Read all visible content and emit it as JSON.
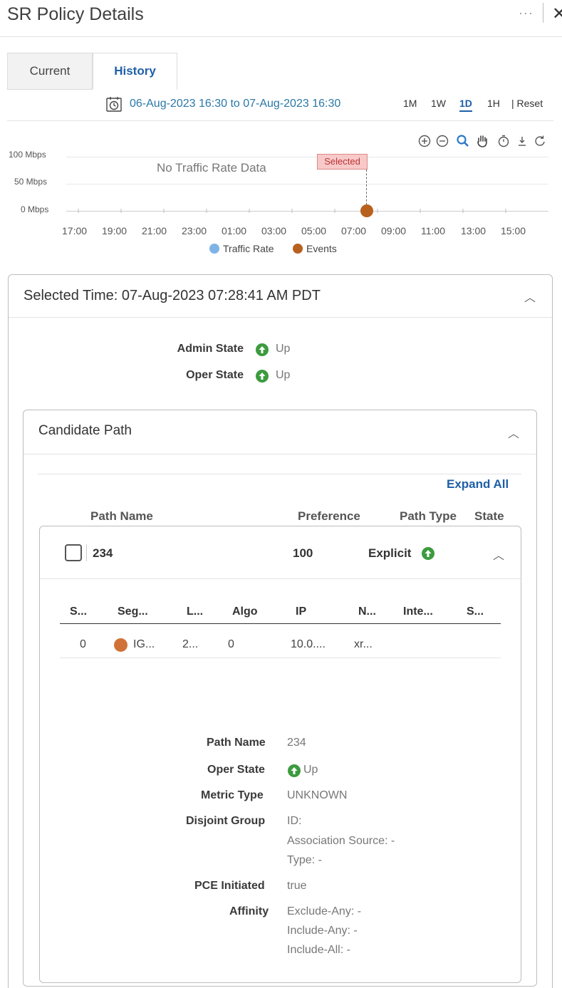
{
  "header": {
    "title": "SR Policy Details",
    "more": "···",
    "close": "✕"
  },
  "tabs": [
    {
      "label": "Current"
    },
    {
      "label": "History"
    }
  ],
  "history": {
    "date_range": "06-Aug-2023 16:30 to 07-Aug-2023 16:30",
    "ranges": [
      "1M",
      "1W",
      "1D",
      "1H"
    ],
    "reset": "| Reset",
    "tools": [
      "zoom-in-icon",
      "zoom-out-icon",
      "magnify-icon",
      "pan-hand-icon",
      "timer-icon",
      "download-icon",
      "refresh-icon"
    ]
  },
  "chart_data": {
    "type": "line",
    "y_ticks": [
      "100 Mbps",
      "50 Mbps",
      "0 Mbps"
    ],
    "x_ticks": [
      "17:00",
      "19:00",
      "21:00",
      "23:00",
      "01:00",
      "03:00",
      "05:00",
      "07:00",
      "09:00",
      "11:00",
      "13:00",
      "15:00"
    ],
    "no_data_text": "No Traffic Rate Data",
    "selected_label": "Selected",
    "series": [
      {
        "name": "Traffic Rate",
        "color": "#7eb3e6",
        "values": []
      },
      {
        "name": "Events",
        "color": "#b8611e",
        "points": [
          {
            "x": "07:28",
            "y": 0
          }
        ]
      }
    ]
  },
  "selected": {
    "title": "Selected Time: 07-Aug-2023 07:28:41 AM PDT",
    "admin_label": "Admin State",
    "admin_value": "Up",
    "oper_label": "Oper State",
    "oper_value": "Up"
  },
  "candidate": {
    "title": "Candidate Path",
    "expand_all": "Expand All",
    "columns": {
      "path_name": "Path Name",
      "preference": "Preference",
      "path_type": "Path Type",
      "state": "State"
    },
    "row": {
      "name": "234",
      "preference": "100",
      "type": "Explicit"
    },
    "segments": {
      "headers": [
        "S...",
        "Seg...",
        "L...",
        "Algo",
        "IP",
        "N...",
        "Inte...",
        "S..."
      ],
      "row": [
        "0",
        "IG...",
        "2...",
        "0",
        "10.0....",
        "xr..."
      ]
    },
    "details": {
      "path_name_label": "Path Name",
      "path_name_value": "234",
      "oper_label": "Oper State",
      "oper_value": "Up",
      "metric_label": "Metric Type",
      "metric_value": "UNKNOWN",
      "disjoint_label": "Disjoint Group",
      "disjoint_id": "ID:",
      "disjoint_source": "Association Source: -",
      "disjoint_type": "Type: -",
      "pce_label": "PCE Initiated",
      "pce_value": "true",
      "affinity_label": "Affinity",
      "affinity_exclude": "Exclude-Any: -",
      "affinity_include_any": "Include-Any: -",
      "affinity_include_all": "Include-All: -"
    }
  },
  "colors": {
    "accent": "#1e5fa8",
    "date_link": "#2a78a8",
    "up_green": "#3c9b3f",
    "event": "#b8611e"
  }
}
